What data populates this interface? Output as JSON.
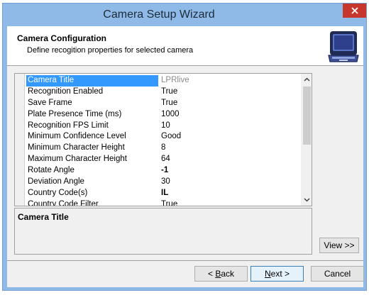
{
  "window": {
    "title": "Camera Setup Wizard"
  },
  "header": {
    "title": "Camera Configuration",
    "subtitle": "Define recogition properties for selected camera",
    "icon": "laptop-camera-icon"
  },
  "properties": [
    {
      "name": "Camera Title",
      "value": "LPRlive",
      "selected": true
    },
    {
      "name": "Recognition Enabled",
      "value": "True"
    },
    {
      "name": "Save Frame",
      "value": "True"
    },
    {
      "name": "Plate Presence Time (ms)",
      "value": "1000"
    },
    {
      "name": "Recognition FPS Limit",
      "value": "10"
    },
    {
      "name": "Minimum Confidence Level",
      "value": "Good"
    },
    {
      "name": "Minimum Character Height",
      "value": "8"
    },
    {
      "name": "Maximum Character Height",
      "value": "64"
    },
    {
      "name": "Rotate Angle",
      "value": "-1",
      "bold": true
    },
    {
      "name": "Deviation Angle",
      "value": "30"
    },
    {
      "name": "Country Code(s)",
      "value": "IL",
      "bold": true
    },
    {
      "name": "Country Code Filter",
      "value": "True"
    }
  ],
  "description": {
    "title": "Camera Title"
  },
  "buttons": {
    "view": "View >>",
    "back_prefix": "",
    "back_mnemonic": "B",
    "back_rest": "ack",
    "back_arrow": "< ",
    "next_mnemonic": "N",
    "next_rest": "ext >",
    "cancel": "Cancel"
  },
  "colors": {
    "title_bar": "#8fb9e6",
    "close_button": "#c7362c",
    "selection": "#3399ff"
  }
}
